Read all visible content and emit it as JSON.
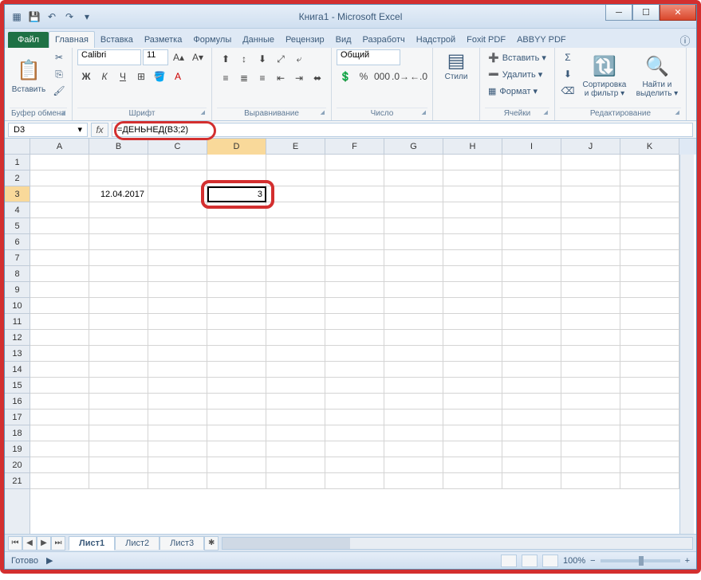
{
  "title": "Книга1 - Microsoft Excel",
  "qat": {
    "save": "💾",
    "undo": "↶",
    "redo": "↷"
  },
  "tabs": {
    "file": "Файл",
    "list": [
      "Главная",
      "Вставка",
      "Разметка",
      "Формулы",
      "Данные",
      "Рецензир",
      "Вид",
      "Разработч",
      "Надстрой",
      "Foxit PDF",
      "ABBYY PDF"
    ],
    "active": 0
  },
  "ribbon": {
    "clipboard": {
      "paste": "Вставить",
      "label": "Буфер обмена"
    },
    "font": {
      "name": "Calibri",
      "size": "11",
      "label": "Шрифт"
    },
    "align": {
      "label": "Выравнивание"
    },
    "number": {
      "format": "Общий",
      "label": "Число"
    },
    "styles": {
      "btn": "Стили"
    },
    "cells": {
      "insert": "Вставить ▾",
      "delete": "Удалить ▾",
      "format": "Формат ▾",
      "label": "Ячейки"
    },
    "editing": {
      "sort": "Сортировка\nи фильтр ▾",
      "find": "Найти и\nвыделить ▾",
      "label": "Редактирование"
    }
  },
  "formula_bar": {
    "cell_ref": "D3",
    "formula": "=ДЕНЬНЕД(B3;2)"
  },
  "grid": {
    "cols": [
      "A",
      "B",
      "C",
      "D",
      "E",
      "F",
      "G",
      "H",
      "I",
      "J",
      "K"
    ],
    "rows": 21,
    "active_col": "D",
    "active_row": 3,
    "data": {
      "B3": "12.04.2017",
      "D3": "3"
    }
  },
  "sheets": {
    "list": [
      "Лист1",
      "Лист2",
      "Лист3"
    ],
    "active": 0
  },
  "status": {
    "ready": "Готово",
    "zoom": "100%"
  }
}
